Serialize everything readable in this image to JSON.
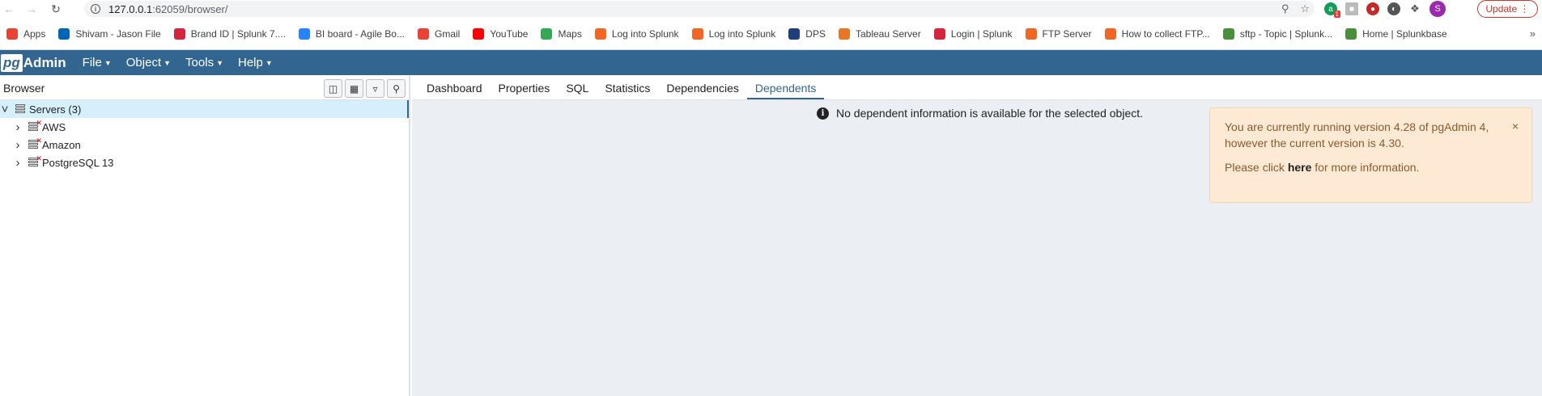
{
  "browser": {
    "url_host": "127.0.0.1",
    "url_path": ":62059/browser/",
    "update_label": "Update",
    "profile_initial": "S",
    "ext_badge": "1"
  },
  "bookmarks": [
    {
      "label": "Apps",
      "icon": "apps-grid-icon",
      "color": "#ea4335"
    },
    {
      "label": "Shivam - Jason File",
      "icon": "onedrive-cloud-icon",
      "color": "#0364b8"
    },
    {
      "label": "Brand ID | Splunk 7....",
      "icon": "splunk-red-icon",
      "color": "#d6243d"
    },
    {
      "label": "BI board - Agile Bo...",
      "icon": "jira-diamond-icon",
      "color": "#2684ff"
    },
    {
      "label": "Gmail",
      "icon": "gmail-icon",
      "color": "#ea4335"
    },
    {
      "label": "YouTube",
      "icon": "youtube-icon",
      "color": "#ff0000"
    },
    {
      "label": "Maps",
      "icon": "maps-pin-icon",
      "color": "#34a853"
    },
    {
      "label": "Log into Splunk",
      "icon": "splunk-orange-icon",
      "color": "#f26522"
    },
    {
      "label": "Log into Splunk",
      "icon": "splunk-orange-icon",
      "color": "#f26522"
    },
    {
      "label": "DPS",
      "icon": "dps-icon",
      "color": "#1f3f7a"
    },
    {
      "label": "Tableau Server",
      "icon": "tableau-icon",
      "color": "#e97627"
    },
    {
      "label": "Login | Splunk",
      "icon": "splunk-red-icon",
      "color": "#d6243d"
    },
    {
      "label": "FTP Server",
      "icon": "splunk-orange-icon",
      "color": "#f26522"
    },
    {
      "label": "How to collect FTP...",
      "icon": "splunk-orange-icon",
      "color": "#f26522"
    },
    {
      "label": "sftp - Topic | Splunk...",
      "icon": "splunkbase-icon",
      "color": "#4a8f3c"
    },
    {
      "label": "Home | Splunkbase",
      "icon": "splunkbase-icon",
      "color": "#4a8f3c"
    }
  ],
  "app": {
    "brand_pg": "pg",
    "brand_admin": "Admin",
    "menus": [
      "File",
      "Object",
      "Tools",
      "Help"
    ]
  },
  "browser_pane": {
    "title": "Browser",
    "tree": [
      {
        "label": "Servers (3)",
        "level": 0,
        "expanded": true
      },
      {
        "label": "AWS",
        "level": 1,
        "expanded": false
      },
      {
        "label": "Amazon",
        "level": 1,
        "expanded": false
      },
      {
        "label": "PostgreSQL 13",
        "level": 1,
        "expanded": false
      }
    ]
  },
  "tabs": [
    "Dashboard",
    "Properties",
    "SQL",
    "Statistics",
    "Dependencies",
    "Dependents"
  ],
  "active_tab": "Dependents",
  "empty_message": "No dependent information is available for the selected object.",
  "alert": {
    "line1": "You are currently running version 4.28 of pgAdmin 4,",
    "line2": "however the current version is 4.30.",
    "pre": "Please click ",
    "link": "here",
    "post": " for more information.",
    "close": "×"
  }
}
